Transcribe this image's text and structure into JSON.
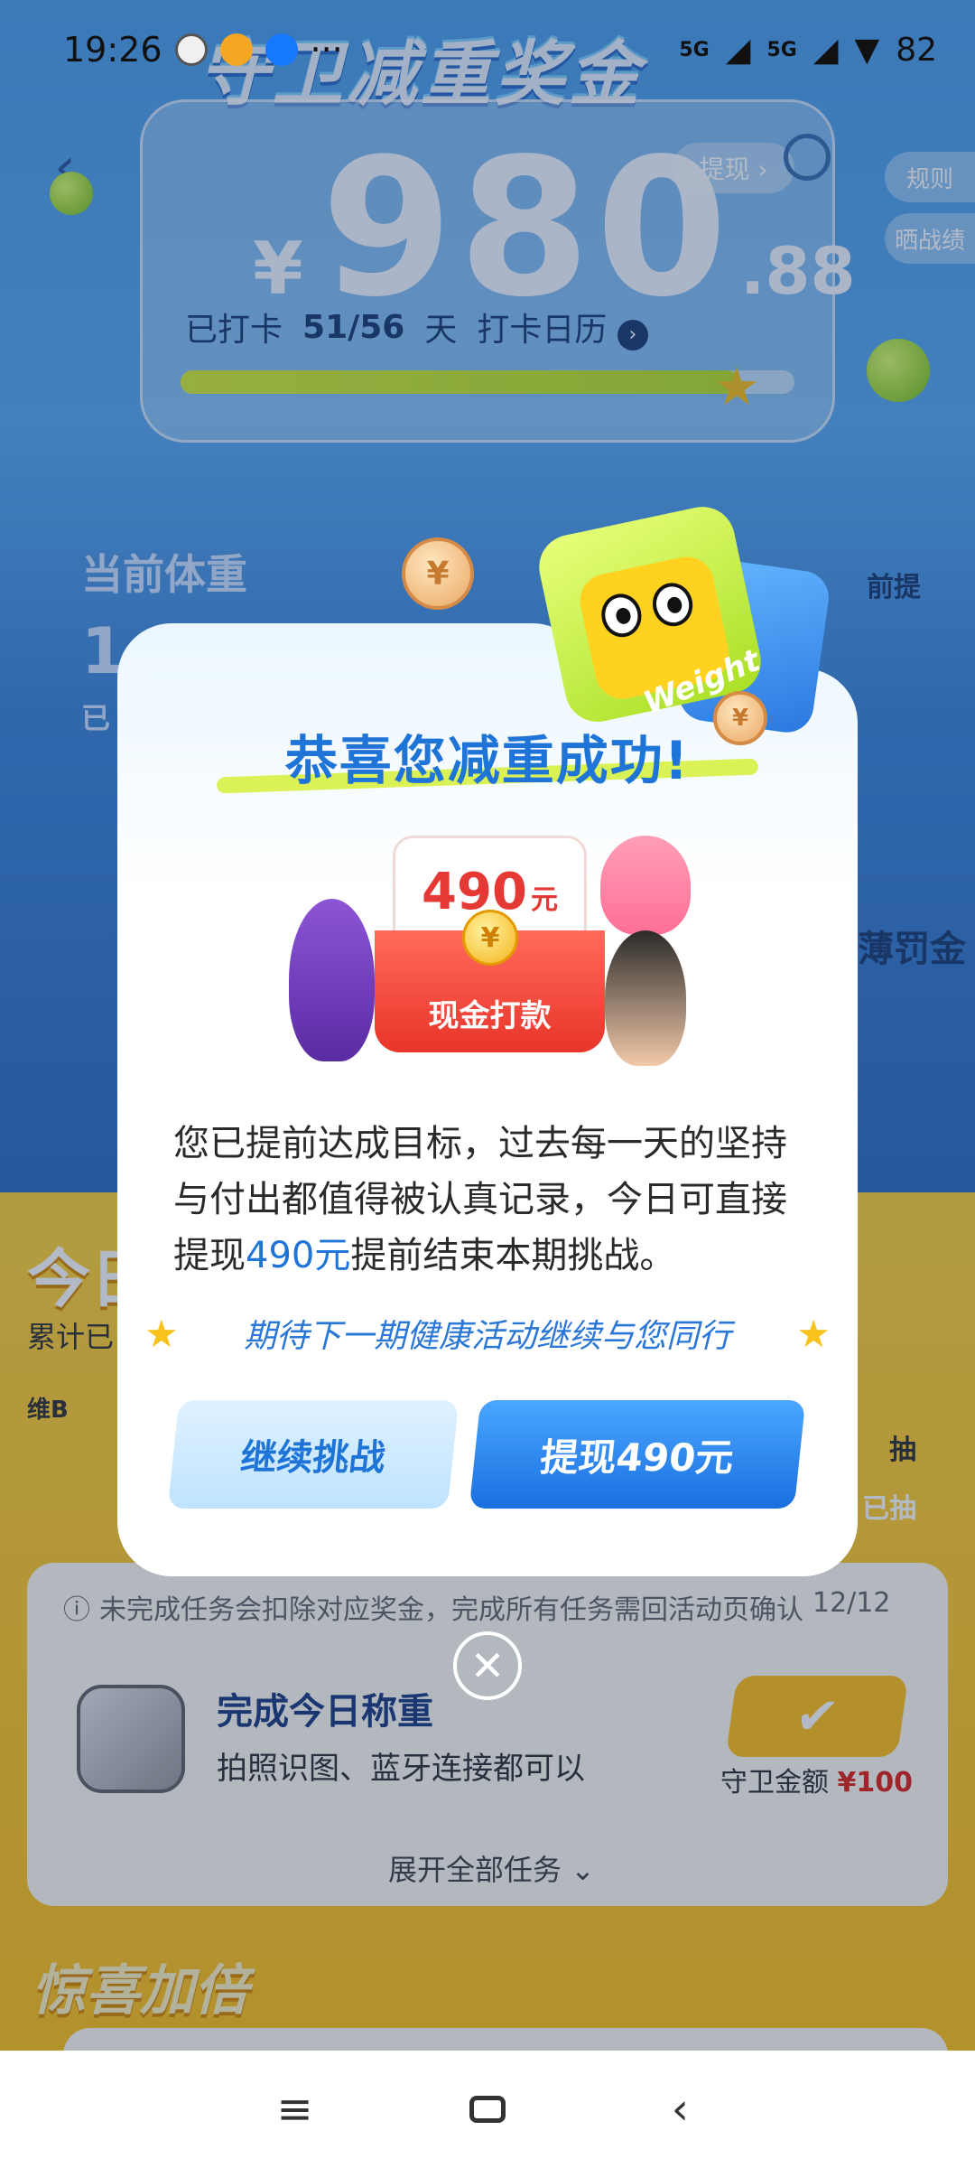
{
  "status_bar": {
    "time": "19:26",
    "app_icons": [
      "weibo-like-icon",
      "weibo-icon",
      "alipay-icon"
    ],
    "more": "···",
    "signal1": "5G",
    "signal2": "5G",
    "battery": "82"
  },
  "background": {
    "title": "守卫减重奖金",
    "amount_symbol": "¥",
    "amount_int": "980",
    "amount_dec": ".88",
    "withdraw_pill": "提现 ›",
    "side_rules": "规则",
    "side_share": "晒战绩",
    "checkin_label": "已打卡",
    "checkin_count": "51/56",
    "checkin_unit": "天",
    "calendar_label": "打卡日历",
    "progress_fraction": 0.91,
    "current_weight_label": "当前体重",
    "left_fragment_1": "1",
    "left_fragment_2": "已",
    "right_fragment_prefix": "前提",
    "right_fragment_penalty": "薄罚金",
    "today_fragment": "今日",
    "cumulative_fragment": "累计已",
    "draw_fragment": "抽",
    "drawn_fragment": "已抽",
    "b_fragment": "维B"
  },
  "task_card": {
    "warning": "未完成任务会扣除对应奖金，完成所有任务需回活动页确认",
    "progress": "12/12",
    "title": "完成今日称重",
    "subtitle": "拍照识图、蓝牙连接都可以",
    "guard_label": "守卫金额",
    "guard_value": "¥100",
    "expand": "展开全部任务 ⌄"
  },
  "surprise_title": "惊喜加倍",
  "modal": {
    "title": "恭喜您减重成功!",
    "envelope_amount": "490",
    "envelope_unit": "元",
    "envelope_label": "现金打款",
    "mascot_text": "Weight",
    "desc_part1": "您已提前达成目标，过去每一天的坚持与付出都值得被认真记录，今日可直接提现",
    "desc_highlight": "490元",
    "desc_part2": "提前结束本期挑战。",
    "slogan": "期待下一期健康活动继续与您同行",
    "btn_continue": "继续挑战",
    "btn_withdraw": "提现490元",
    "close": "✕"
  },
  "nav_bar": {
    "menu": "≡",
    "back": "‹"
  },
  "colors": {
    "brand_blue": "#1f74d8",
    "red": "#e53935",
    "yellow": "#ffc21a"
  }
}
